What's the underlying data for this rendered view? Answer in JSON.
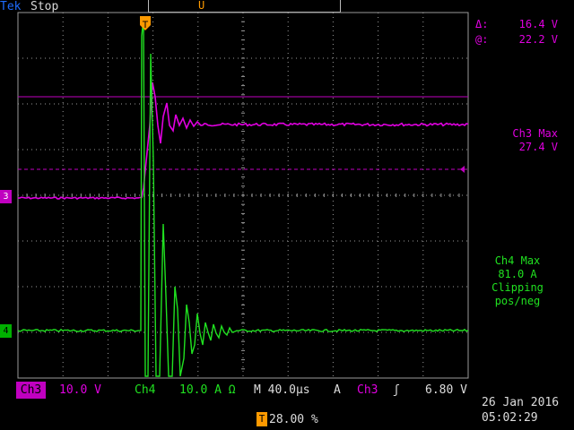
{
  "status_bar": {
    "brand": "Tek",
    "run_state": "Stop"
  },
  "record": {
    "marker_label": "U"
  },
  "trigger_marker_label": "T",
  "cursor_readout": {
    "delta_symbol": "Δ:",
    "delta_value": "16.4 V",
    "at_symbol": "@:",
    "at_value": "22.2 V"
  },
  "measurements": {
    "ch3": {
      "title": "Ch3 Max",
      "value": "27.4 V"
    },
    "ch4": {
      "title": "Ch4 Max",
      "value": "81.0 A",
      "note1": "Clipping",
      "note2": "pos/neg"
    }
  },
  "channel_markers": {
    "ch3": "3",
    "ch4": "4"
  },
  "bottom": {
    "ch3_label": "Ch3",
    "ch3_scale": "10.0 V",
    "ch4_label": "Ch4",
    "ch4_scale": "10.0 A Ω",
    "timebase": "M 40.0µs",
    "acq_mode": "A",
    "trigger_source": "Ch3",
    "trigger_slope": "ʃ",
    "trigger_level": "6.80 V",
    "trigger_position_icon": "T",
    "trigger_position": "28.00 %",
    "date": "26 Jan  2016",
    "time": "05:02:29"
  },
  "colors": {
    "ch3": "#e000e0",
    "ch4": "#20e020",
    "grid": "#9a9a9a",
    "accent": "#ff9a00",
    "brand": "#1e6cff"
  }
}
